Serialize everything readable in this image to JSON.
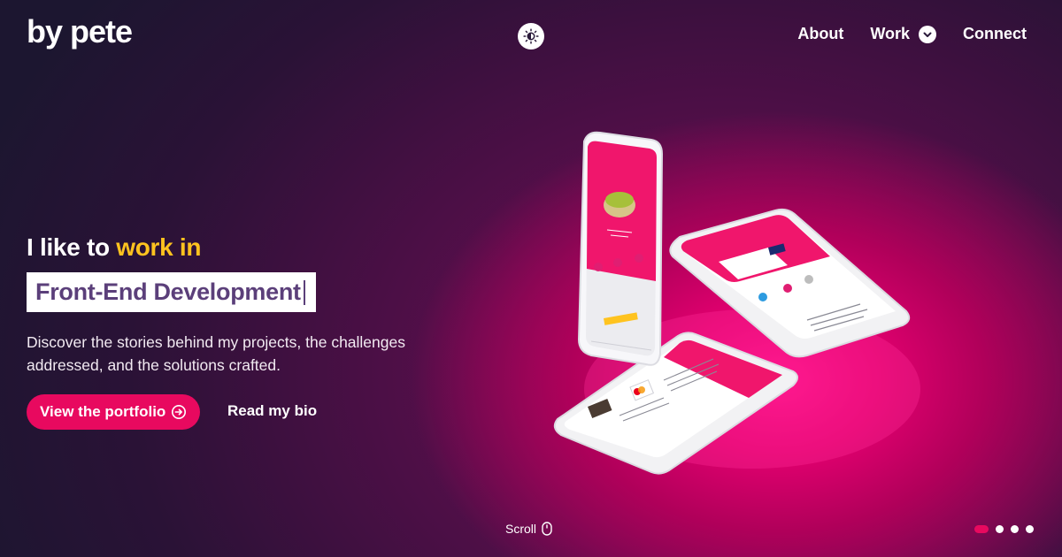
{
  "brand": {
    "logo_text": "by pete"
  },
  "header": {
    "theme_toggle_icon": "moon-sun-icon",
    "nav": [
      {
        "label": "About"
      },
      {
        "label": "Work",
        "icon": "chevron-down-icon"
      },
      {
        "label": "Connect"
      }
    ]
  },
  "hero": {
    "headline_prefix": "I like to ",
    "headline_accent": "work in",
    "typed_text": "Front-End Development",
    "description_line1": "Discover the stories behind my projects, the challenges",
    "description_line2": "addressed, and the solutions crafted.",
    "primary_button": "View the portfolio",
    "primary_button_icon": "arrow-right-circle-icon",
    "secondary_button": "Read my bio"
  },
  "footer": {
    "scroll_label": "Scroll",
    "scroll_icon": "mouse-icon",
    "pagination_total": 4,
    "pagination_active": 1
  },
  "colors": {
    "accent_pink": "#e8095f",
    "accent_yellow": "#ffc31f",
    "typed_text": "#5b3f7a",
    "background_dark": "#1d1730"
  }
}
